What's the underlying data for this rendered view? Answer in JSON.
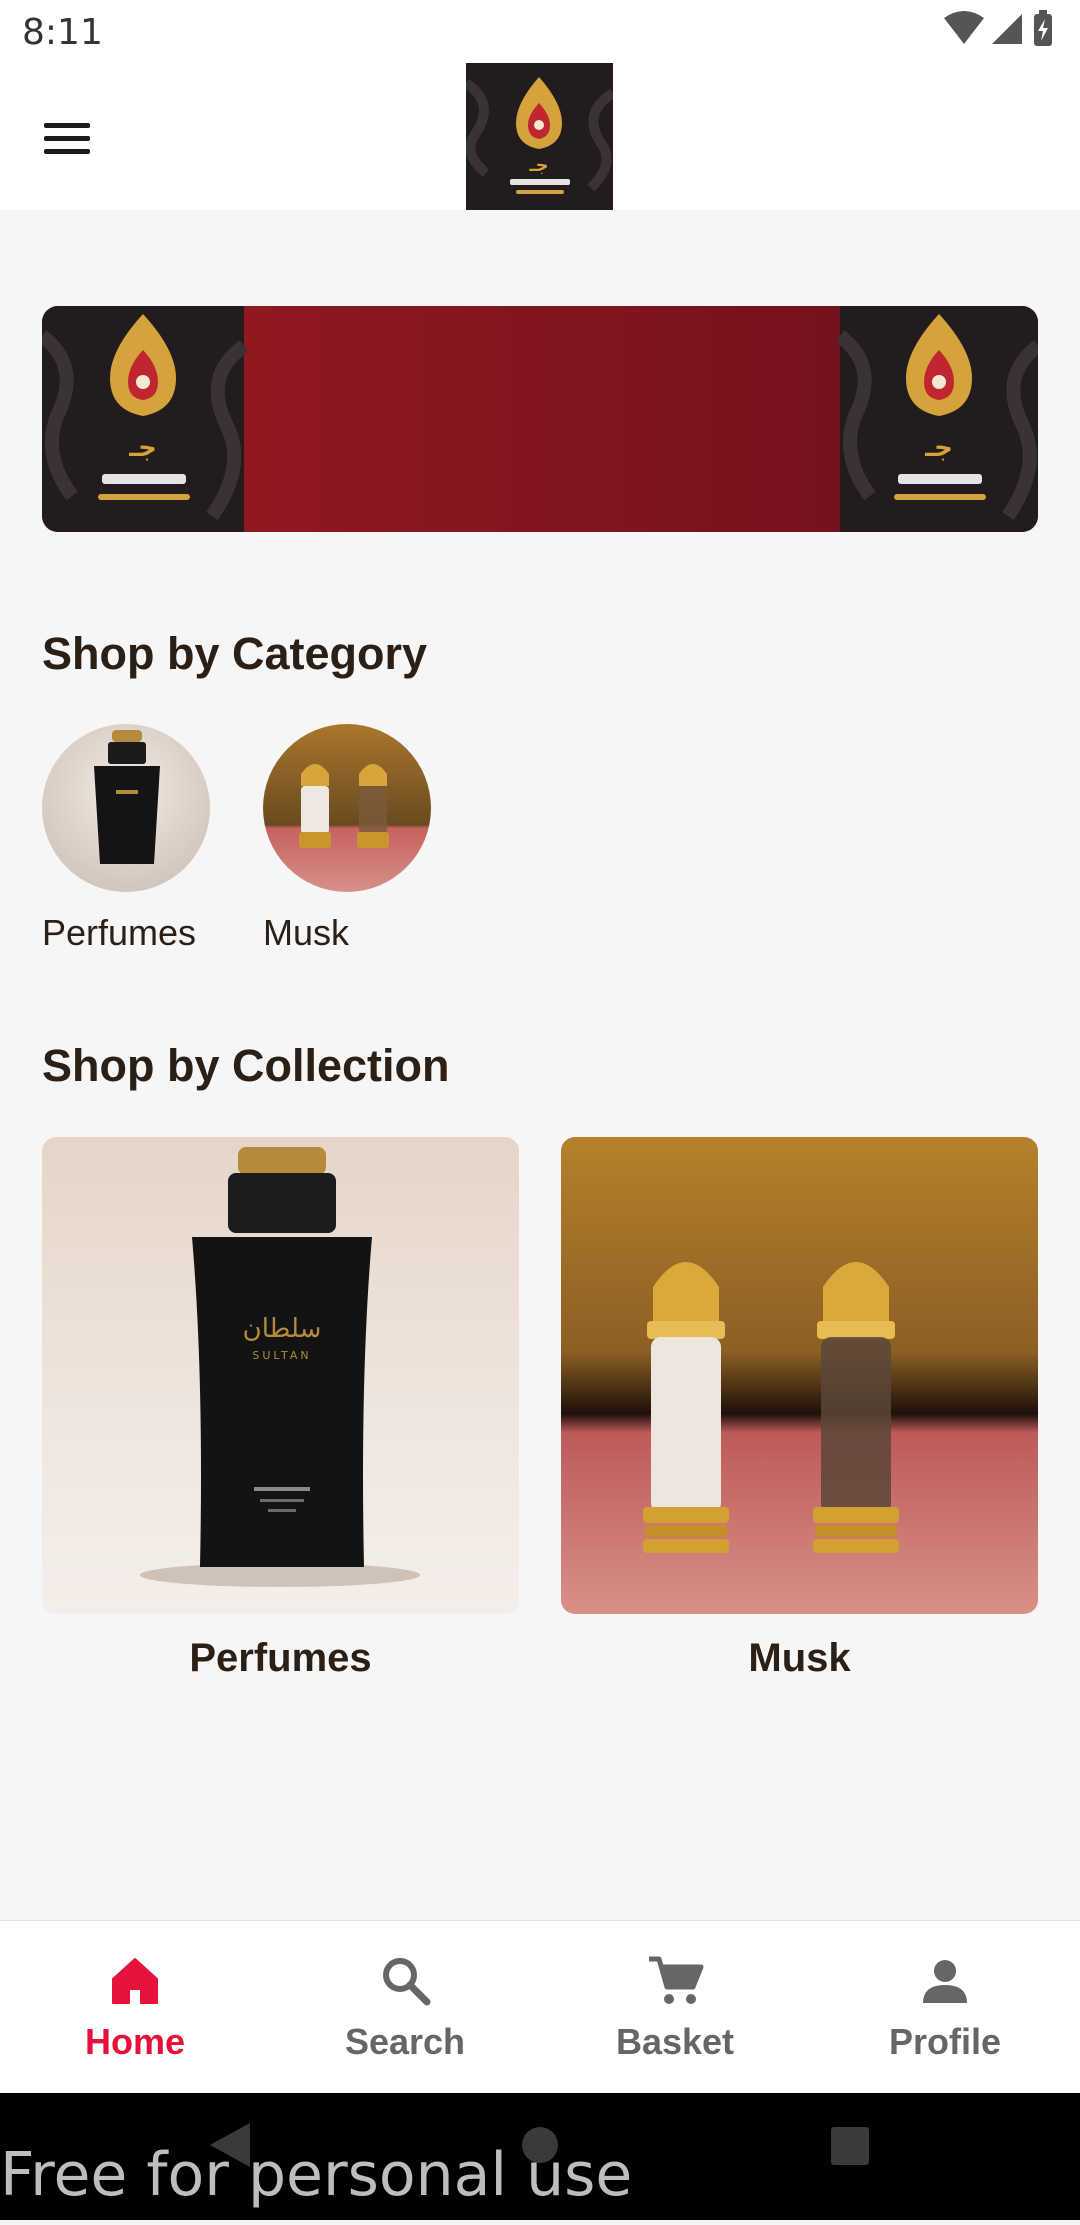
{
  "status_bar": {
    "time": "8:11"
  },
  "app_bar": {
    "logo": "atyab-aljazi-logo"
  },
  "banner": {
    "logo": "atyab-aljazi-logo"
  },
  "categories": {
    "title": "Shop by Category",
    "items": [
      {
        "label": "Perfumes",
        "image": "perfume-bottle"
      },
      {
        "label": "Musk",
        "image": "musk-bottles"
      }
    ]
  },
  "collections": {
    "title": "Shop by Collection",
    "items": [
      {
        "label": "Perfumes",
        "image": "perfume-bottle"
      },
      {
        "label": "Musk",
        "image": "musk-bottles"
      }
    ]
  },
  "bottom_nav": {
    "items": [
      {
        "label": "Home",
        "icon": "home-icon",
        "active": true
      },
      {
        "label": "Search",
        "icon": "search-icon",
        "active": false
      },
      {
        "label": "Basket",
        "icon": "cart-icon",
        "active": false
      },
      {
        "label": "Profile",
        "icon": "person-icon",
        "active": false
      }
    ]
  },
  "watermark": "Free for personal use",
  "colors": {
    "accent": "#e5123b",
    "text": "#2b1f16",
    "banner_red": "#8a1520",
    "logo_bg": "#231c1e",
    "gold": "#d4a33b"
  }
}
